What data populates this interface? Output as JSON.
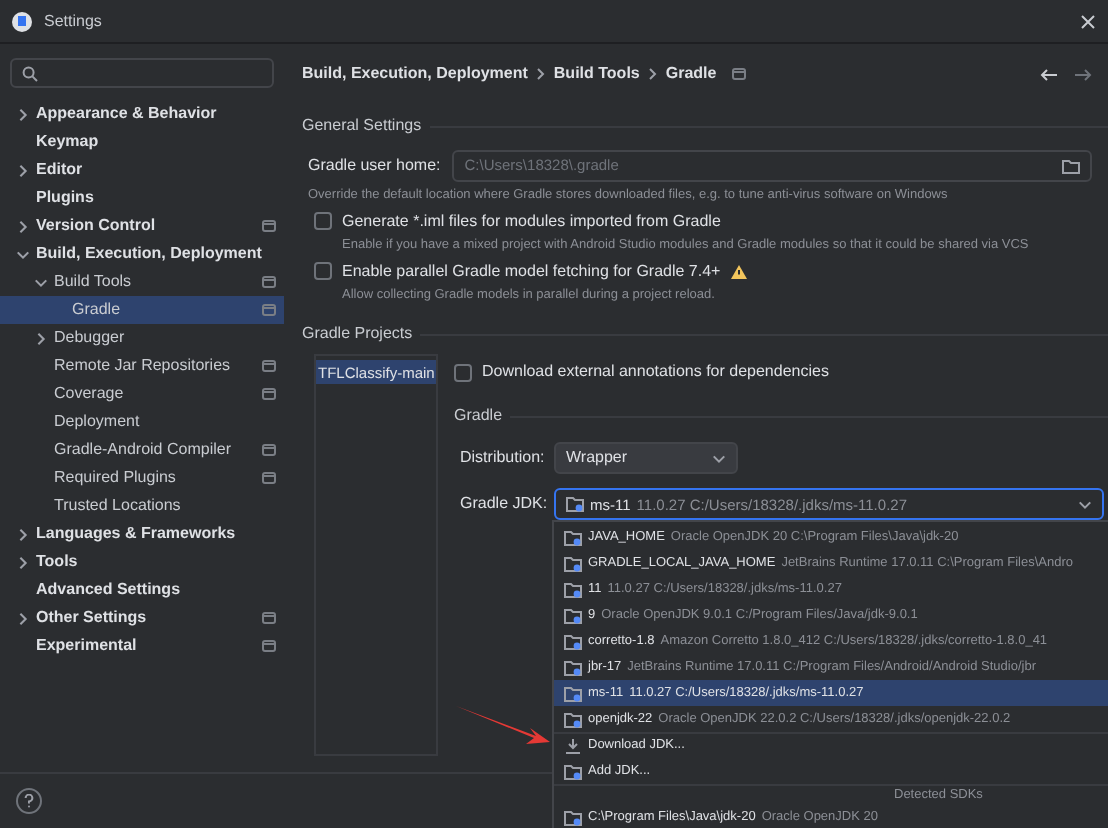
{
  "window": {
    "title": "Settings"
  },
  "sidebar": {
    "items": [
      {
        "label": "Appearance & Behavior",
        "expanded": false,
        "selected": false,
        "project_scope": false
      },
      {
        "label": "Keymap",
        "selected": false,
        "project_scope": false
      },
      {
        "label": "Editor",
        "expanded": false,
        "selected": false,
        "project_scope": false
      },
      {
        "label": "Plugins",
        "selected": false,
        "project_scope": false
      },
      {
        "label": "Version Control",
        "expanded": false,
        "selected": false,
        "project_scope": true
      },
      {
        "label": "Build, Execution, Deployment",
        "expanded": true,
        "selected": false,
        "project_scope": false,
        "children": [
          {
            "label": "Build Tools",
            "expanded": true,
            "selected": false,
            "project_scope": true,
            "children": [
              {
                "label": "Gradle",
                "selected": true,
                "project_scope": true
              }
            ]
          },
          {
            "label": "Debugger",
            "expanded": false,
            "selected": false,
            "project_scope": false
          },
          {
            "label": "Remote Jar Repositories",
            "selected": false,
            "project_scope": true
          },
          {
            "label": "Coverage",
            "selected": false,
            "project_scope": true
          },
          {
            "label": "Deployment",
            "selected": false,
            "project_scope": false
          },
          {
            "label": "Gradle-Android Compiler",
            "selected": false,
            "project_scope": true
          },
          {
            "label": "Required Plugins",
            "selected": false,
            "project_scope": true
          },
          {
            "label": "Trusted Locations",
            "selected": false,
            "project_scope": false
          }
        ]
      },
      {
        "label": "Languages & Frameworks",
        "expanded": false,
        "selected": false,
        "project_scope": false
      },
      {
        "label": "Tools",
        "expanded": false,
        "selected": false,
        "project_scope": false
      },
      {
        "label": "Advanced Settings",
        "selected": false,
        "project_scope": false
      },
      {
        "label": "Other Settings",
        "expanded": false,
        "selected": false,
        "project_scope": true
      },
      {
        "label": "Experimental",
        "selected": false,
        "project_scope": true
      }
    ]
  },
  "breadcrumb": [
    "Build, Execution, Deployment",
    "Build Tools",
    "Gradle"
  ],
  "general": {
    "title": "General Settings",
    "user_home_label": "Gradle user home:",
    "user_home_value": "C:\\Users\\18328\\.gradle",
    "user_home_hint": "Override the default location where Gradle stores downloaded files, e.g. to tune anti-virus software on Windows",
    "checkboxes": [
      {
        "label": "Generate *.iml files for modules imported from Gradle",
        "hint": "Enable if you have a mixed project with Android Studio modules and Gradle modules so that it could be shared via VCS",
        "checked": false,
        "warning": false
      },
      {
        "label": "Enable parallel Gradle model fetching for Gradle 7.4+",
        "hint": "Allow collecting Gradle models in parallel during a project reload.",
        "checked": false,
        "warning": true
      }
    ]
  },
  "projects": {
    "title": "Gradle Projects",
    "items": [
      {
        "name": "TFLClassify-main",
        "selected": true
      }
    ],
    "annotations_checkbox": {
      "label": "Download external annotations for dependencies",
      "checked": false
    },
    "gradle_title": "Gradle",
    "distribution_label": "Distribution:",
    "distribution_value": "Wrapper",
    "jdk_label": "Gradle JDK:",
    "jdk_value": {
      "name": "ms-11",
      "detail": "11.0.27 C:/Users/18328/.jdks/ms-11.0.27"
    }
  },
  "jdk_popup": {
    "items": [
      {
        "kind": "jdk",
        "name": "JAVA_HOME",
        "detail": "Oracle OpenJDK 20 C:\\Program Files\\Java\\jdk-20",
        "selected": false
      },
      {
        "kind": "jdk",
        "name": "GRADLE_LOCAL_JAVA_HOME",
        "detail": "JetBrains Runtime 17.0.11 C:\\Program Files\\Andro",
        "selected": false
      },
      {
        "kind": "jdk",
        "name": "11",
        "detail": "11.0.27 C:/Users/18328/.jdks/ms-11.0.27",
        "selected": false
      },
      {
        "kind": "jdk",
        "name": "9",
        "detail": "Oracle OpenJDK 9.0.1 C:/Program Files/Java/jdk-9.0.1",
        "selected": false
      },
      {
        "kind": "jdk",
        "name": "corretto-1.8",
        "detail": "Amazon Corretto 1.8.0_412 C:/Users/18328/.jdks/corretto-1.8.0_41",
        "selected": false
      },
      {
        "kind": "jdk",
        "name": "jbr-17",
        "detail": "JetBrains Runtime 17.0.11 C:/Program Files/Android/Android Studio/jbr",
        "selected": false
      },
      {
        "kind": "jdk",
        "name": "ms-11",
        "detail": "11.0.27 C:/Users/18328/.jdks/ms-11.0.27",
        "selected": true
      },
      {
        "kind": "jdk",
        "name": "openjdk-22",
        "detail": "Oracle OpenJDK 22.0.2 C:/Users/18328/.jdks/openjdk-22.0.2",
        "selected": false
      },
      {
        "kind": "download",
        "name": "Download JDK...",
        "selected": false
      },
      {
        "kind": "add",
        "name": "Add JDK...",
        "selected": false
      },
      {
        "kind": "header",
        "name": "Detected SDKs"
      },
      {
        "kind": "jdk",
        "name": "C:\\Program Files\\Java\\jdk-20",
        "detail": "Oracle OpenJDK 20",
        "selected": false
      }
    ]
  }
}
